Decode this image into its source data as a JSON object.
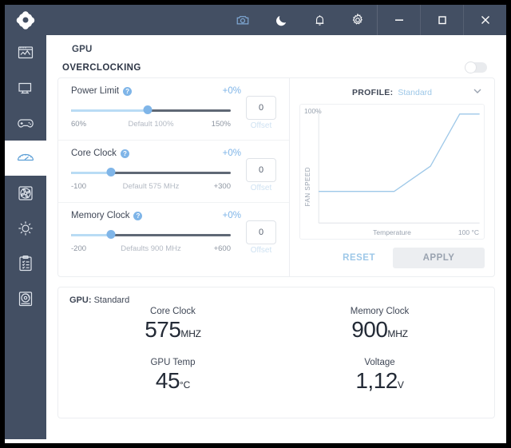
{
  "colors": {
    "titlebar_bg": "#434f63",
    "accent_blue": "#7fb5e8",
    "light_blue": "#b9dcf5",
    "track_dark": "#5f6875",
    "text_dark": "#3f4756"
  },
  "titlebar": {
    "logo_icon": "clover-logo-icon",
    "icons": [
      {
        "name": "screenshot-camera-icon",
        "active": true
      },
      {
        "name": "night-mode-moon-icon",
        "active": false
      },
      {
        "name": "notifications-bell-icon",
        "active": false
      },
      {
        "name": "settings-gear-icon",
        "active": false
      }
    ],
    "window_buttons": [
      {
        "name": "minimize-button",
        "glyph": "minimize-icon"
      },
      {
        "name": "maximize-button",
        "glyph": "maximize-icon"
      },
      {
        "name": "close-button",
        "glyph": "close-icon"
      }
    ]
  },
  "sidebar": {
    "items": [
      {
        "name": "sidebar-item-dashboard",
        "icon": "report-chart-icon",
        "active": false
      },
      {
        "name": "sidebar-item-system",
        "icon": "monitor-icon",
        "active": false
      },
      {
        "name": "sidebar-item-games",
        "icon": "gamepad-icon",
        "active": false
      },
      {
        "name": "sidebar-item-overclocking",
        "icon": "speedometer-icon",
        "active": true
      },
      {
        "name": "sidebar-item-fan",
        "icon": "fan-icon",
        "active": false
      },
      {
        "name": "sidebar-item-lighting",
        "icon": "brightness-sun-icon",
        "active": false
      },
      {
        "name": "sidebar-item-tasks",
        "icon": "clipboard-checklist-icon",
        "active": false
      },
      {
        "name": "sidebar-item-media",
        "icon": "disc-drive-icon",
        "active": false
      }
    ]
  },
  "main": {
    "gpu_label": "GPU",
    "section_title": "OVERCLOCKING",
    "toggle_state": "off"
  },
  "sliders": [
    {
      "label": "Power Limit",
      "percent": "+0%",
      "min": "60%",
      "default": "Default  100%",
      "max": "150%",
      "value": "0",
      "offset_label": "Offset",
      "fill_pct": 48
    },
    {
      "label": "Core Clock",
      "percent": "+0%",
      "min": "-100",
      "default": "Default  575 MHz",
      "max": "+300",
      "value": "0",
      "offset_label": "Offset",
      "fill_pct": 25
    },
    {
      "label": "Memory Clock",
      "percent": "+0%",
      "min": "-200",
      "default": "Defaults  900 MHz",
      "max": "+600",
      "value": "0",
      "offset_label": "Offset",
      "fill_pct": 25
    }
  ],
  "profile": {
    "key": "PROFILE:",
    "value": "Standard",
    "chevron": "chevron-down-icon"
  },
  "chart_data": {
    "type": "line",
    "title": "",
    "xlabel": "Temperature",
    "ylabel": "FAN SPEED",
    "y_top_tick": "100%",
    "x_max_tick": "100 °C",
    "xlim": [
      0,
      100
    ],
    "ylim": [
      0,
      100
    ],
    "grid": false,
    "legend": "none",
    "series": [
      {
        "name": "Standard fan curve",
        "color": "#9ec8e8",
        "x": [
          0,
          47,
          70,
          87,
          100
        ],
        "y": [
          30,
          30,
          52,
          100,
          100
        ]
      }
    ]
  },
  "chart_buttons": {
    "reset": "RESET",
    "apply": "APPLY"
  },
  "stats": {
    "head_key": "GPU:",
    "head_value": "Standard",
    "items": [
      {
        "label": "Core Clock",
        "value": "575",
        "unit": "MHZ"
      },
      {
        "label": "Memory Clock",
        "value": "900",
        "unit": "MHZ"
      },
      {
        "label": "GPU Temp",
        "value": "45",
        "unit": "°C"
      },
      {
        "label": "Voltage",
        "value": "1,12",
        "unit": "V"
      }
    ]
  }
}
